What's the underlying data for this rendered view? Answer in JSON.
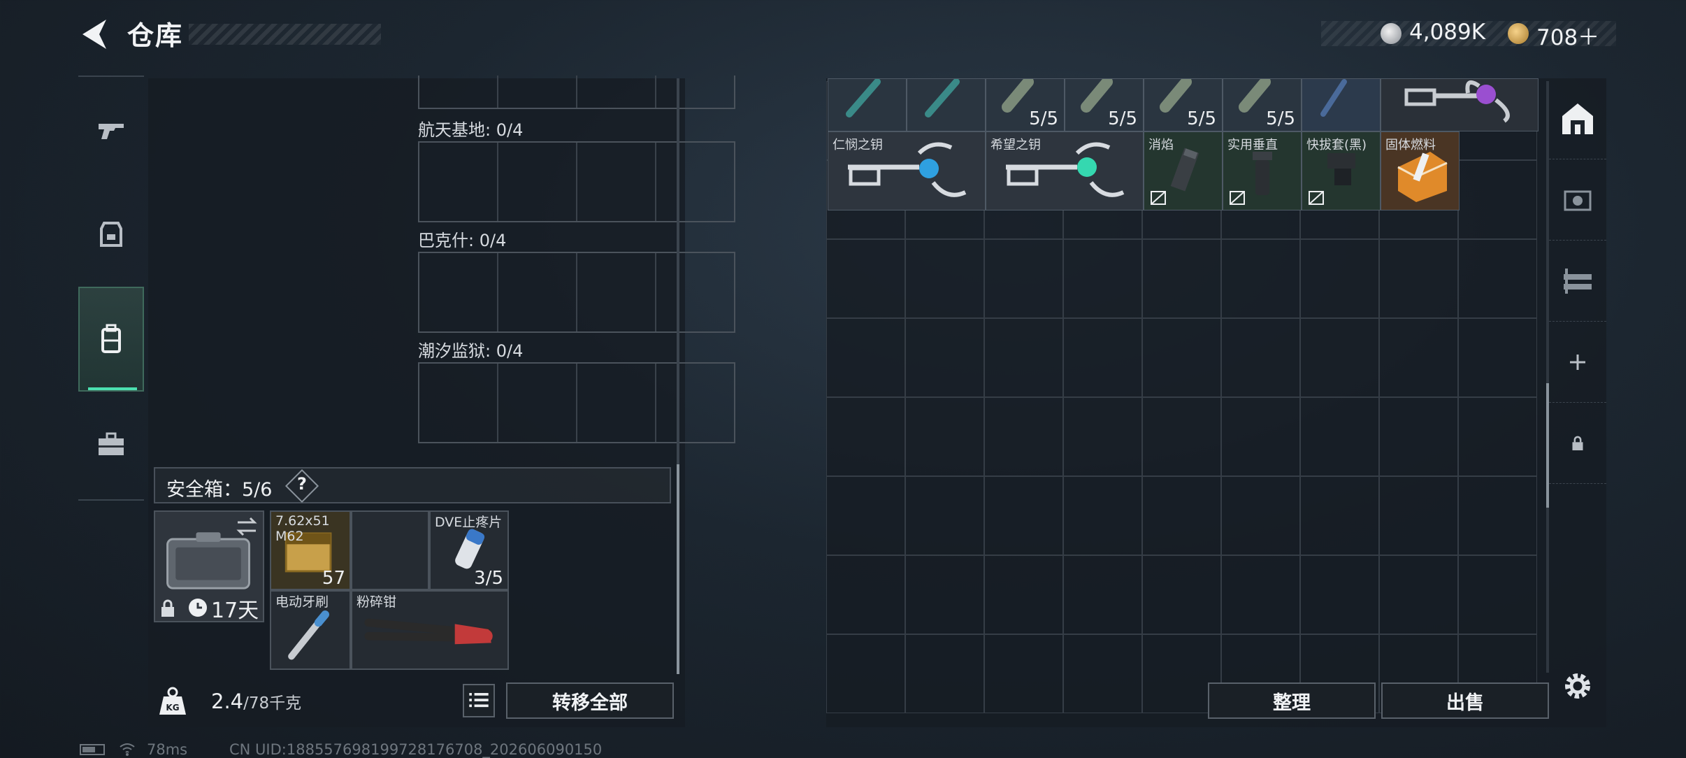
{
  "header": {
    "title": "仓库",
    "currency_silver": "4,089K",
    "currency_gold": "708＋"
  },
  "left_panel": {
    "map_slots": [
      {
        "label": "航天基地: 0/4"
      },
      {
        "label": "巴克什: 0/4"
      },
      {
        "label": "潮汐监狱: 0/4"
      }
    ],
    "safe_box": {
      "title": "安全箱：5/6",
      "help": "?",
      "case_days": "17天",
      "items": [
        {
          "name": "7.62x51\nM62",
          "qty": "57"
        },
        {
          "name": "DVE止疼片",
          "qty": "3/5"
        },
        {
          "name": "电动牙刷",
          "qty": ""
        },
        {
          "name": "粉碎钳",
          "qty": ""
        }
      ]
    },
    "weight_value": "2.4",
    "weight_unit": "/78千克",
    "transfer_all": "转移全部"
  },
  "stash": {
    "top_row_items": [
      {
        "qty": ""
      },
      {
        "qty": ""
      },
      {
        "qty": "5/5"
      },
      {
        "qty": "5/5"
      },
      {
        "qty": "5/5"
      },
      {
        "qty": "5/5"
      },
      {
        "qty": ""
      },
      {
        "qty": ""
      }
    ],
    "row2_items": [
      {
        "name": "仁悯之钥"
      },
      {
        "name": "希望之钥"
      },
      {
        "name": "消焰"
      },
      {
        "name": "实用垂直"
      },
      {
        "name": "快拔套(黑)"
      },
      {
        "name": "固体燃料"
      }
    ],
    "sort_label": "整理",
    "sell_label": "出售",
    "accent_colors": {
      "key_blue": "#2fa0e0",
      "key_green": "#35d8b0",
      "key_purple": "#9a4fd0",
      "fuel_orange": "#e08a2a"
    }
  },
  "status_bar": {
    "ping": "78ms",
    "uid": "CN UID:18855769819972817670​8_202606090150"
  }
}
